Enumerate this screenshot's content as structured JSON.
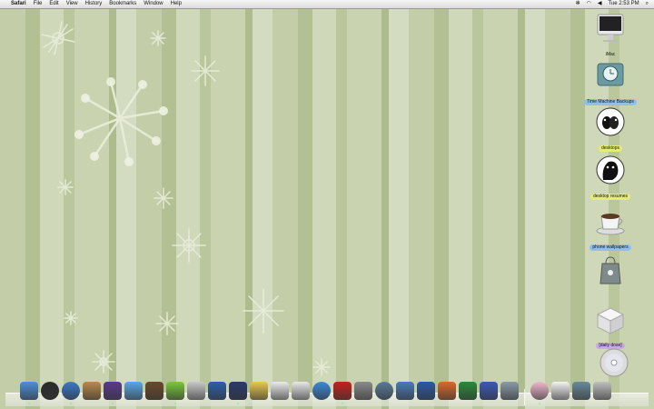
{
  "menubar": {
    "apple": "",
    "app_name": "Safari",
    "menus": [
      "File",
      "Edit",
      "View",
      "History",
      "Bookmarks",
      "Window",
      "Help"
    ],
    "bluetooth": "✻",
    "wifi": "◠",
    "volume": "◀",
    "clock": "Tue 2:53 PM",
    "spotlight": "⌕"
  },
  "desktop": {
    "icons": [
      {
        "label": "iMac",
        "icon": "imac-icon"
      },
      {
        "label": "Time Machine Backups",
        "icon": "time-machine-icon"
      },
      {
        "label": "desktops",
        "icon": "cats-folder-icon"
      },
      {
        "label": "desktop resumes",
        "icon": "cat-folder-icon"
      },
      {
        "label": "phone wallpapers",
        "icon": "coffee-cup-icon"
      },
      {
        "label": "",
        "icon": "shopping-bag-icon"
      },
      {
        "label": "[daily dose]",
        "icon": "box-icon"
      },
      {
        "label": "",
        "icon": "dvd-icon"
      }
    ]
  },
  "dock": {
    "items": [
      "finder-icon",
      "dashboard-icon",
      "safari-icon",
      "address-book-icon",
      "wizard-icon",
      "itunes-icon",
      "photo-booth-icon",
      "green-app-icon",
      "calculator-icon",
      "preview-icon",
      "camino-icon",
      "pen-icon",
      "textedit-icon",
      "ical-icon",
      "quicktime-icon",
      "flash-card-icon",
      "system-preferences-icon",
      "time-machine-dock-icon",
      "fruit-icon",
      "word-icon",
      "powerpoint-icon",
      "excel-icon",
      "bluetooth-icon",
      "utility-icon",
      "ipod-icon",
      "documents-stack-icon",
      "folder-stack-icon",
      "trash-icon"
    ]
  },
  "colors": {
    "menubar_bg": "#e8e8e8",
    "wallpaper": "#c9d3b0",
    "label_blue": "#8ec0ef",
    "label_yellow": "#e4ec7a",
    "label_purple": "#c8a8e8"
  }
}
